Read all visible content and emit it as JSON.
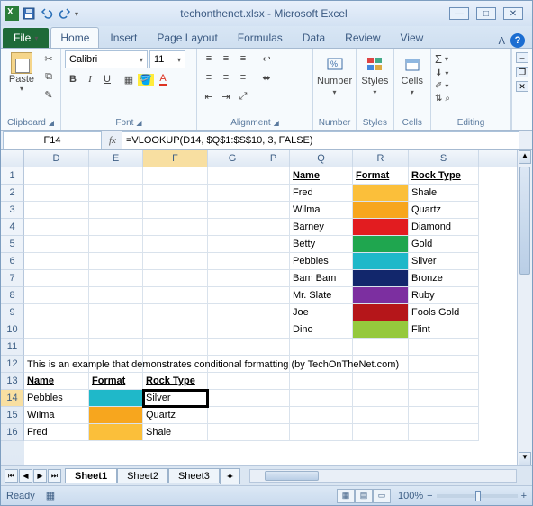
{
  "title": "techonthenet.xlsx - Microsoft Excel",
  "tabs": {
    "file": "File",
    "home": "Home",
    "insert": "Insert",
    "page": "Page Layout",
    "formulas": "Formulas",
    "data": "Data",
    "review": "Review",
    "view": "View"
  },
  "ribbon": {
    "clipboard": {
      "label": "Clipboard",
      "paste": "Paste"
    },
    "font": {
      "label": "Font",
      "name": "Calibri",
      "size": "11"
    },
    "alignment": {
      "label": "Alignment"
    },
    "number": {
      "label": "Number",
      "btn": "Number"
    },
    "styles": {
      "label": "Styles",
      "btn": "Styles"
    },
    "cells": {
      "label": "Cells",
      "btn": "Cells"
    },
    "editing": {
      "label": "Editing"
    }
  },
  "namebox": "F14",
  "formula": "=VLOOKUP(D14, $Q$1:$S$10, 3, FALSE)",
  "cols": [
    "D",
    "E",
    "F",
    "G",
    "P",
    "Q",
    "R",
    "S"
  ],
  "widths": [
    72,
    60,
    72,
    55,
    36,
    70,
    62,
    78
  ],
  "rows": [
    "1",
    "2",
    "3",
    "4",
    "5",
    "6",
    "7",
    "8",
    "9",
    "10",
    "11",
    "12",
    "13",
    "14",
    "15",
    "16"
  ],
  "lookup": {
    "headers": {
      "name": "Name",
      "format": "Format",
      "rock": "Rock Type"
    },
    "rows": [
      {
        "name": "Fred",
        "color": "#fbbf3a",
        "rock": "Shale"
      },
      {
        "name": "Wilma",
        "color": "#f7a61e",
        "rock": "Quartz"
      },
      {
        "name": "Barney",
        "color": "#e21c20",
        "rock": "Diamond"
      },
      {
        "name": "Betty",
        "color": "#1fa64f",
        "rock": "Gold"
      },
      {
        "name": "Pebbles",
        "color": "#1fb8c9",
        "rock": "Silver"
      },
      {
        "name": "Bam Bam",
        "color": "#12276c",
        "rock": "Bronze"
      },
      {
        "name": "Mr. Slate",
        "color": "#7c2fa0",
        "rock": "Ruby"
      },
      {
        "name": "Joe",
        "color": "#b5161a",
        "rock": "Fools Gold"
      },
      {
        "name": "Dino",
        "color": "#95c93d",
        "rock": "Flint"
      }
    ]
  },
  "note": "This is an example that demonstrates conditional formatting (by TechOnTheNet.com)",
  "results": {
    "headers": {
      "name": "Name",
      "format": "Format",
      "rock": "Rock Type"
    },
    "rows": [
      {
        "name": "Pebbles",
        "rock": "Silver",
        "color": "#1fb8c9"
      },
      {
        "name": "Wilma",
        "rock": "Quartz",
        "color": "#f7a61e"
      },
      {
        "name": "Fred",
        "rock": "Shale",
        "color": "#fbbf3a"
      }
    ]
  },
  "sheets": [
    "Sheet1",
    "Sheet2",
    "Sheet3"
  ],
  "status": {
    "ready": "Ready",
    "zoom": "100%"
  }
}
